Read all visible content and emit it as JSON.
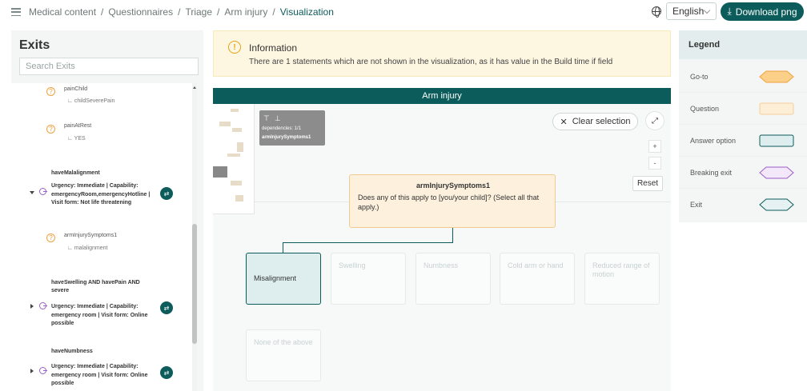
{
  "breadcrumb": {
    "items": [
      "Medical content",
      "Questionnaires",
      "Triage",
      "Arm injury"
    ],
    "active": "Visualization"
  },
  "language": {
    "selected": "English"
  },
  "download_button": {
    "label": "Download png"
  },
  "exits_panel": {
    "title": "Exits",
    "search_placeholder": "Search Exits",
    "questions": [
      {
        "name": "painChild",
        "value": "childSeverePain"
      },
      {
        "name": "painAtRest",
        "value": "YES"
      },
      {
        "name": "armInjurySymptoms1",
        "value": "malalignment"
      }
    ],
    "exits": [
      {
        "title": "haveMalalignment",
        "urgency_lines": [
          "Urgency: Immediate | Capability:",
          "emergencyRoom,emergencyHotline |",
          "Visit form: Not life threatening"
        ]
      },
      {
        "title_lines": [
          "haveSwelling AND havePain AND",
          "severe"
        ],
        "urgency_lines": [
          "Urgency: Immediate | Capability:",
          "emergency room | Visit form: Online",
          "possible"
        ]
      },
      {
        "title": "haveNumbness",
        "urgency_lines": [
          "Urgency: Immediate | Capability:",
          "emergency room | Visit form: Online",
          "possible"
        ]
      }
    ]
  },
  "info": {
    "title": "Information",
    "text": "There are 1 statements which are not shown in the visualization, as it has value in the Build time if field"
  },
  "visualization": {
    "header": "Arm injury",
    "tooltip": {
      "line1": "dependencies: 1/1",
      "line2": "armInjurySymptoms1"
    },
    "clear_selection": "Clear selection",
    "reset": "Reset",
    "question_node": {
      "title": "armInjurySymptoms1",
      "text": "Does any of this apply to [you/your child]? (Select all that apply.)"
    },
    "answers": [
      "Misalignment",
      "Swelling",
      "Numbness",
      "Cold arm or hand",
      "Reduced range of motion",
      "None of the above"
    ]
  },
  "legend": {
    "title": "Legend",
    "items": [
      {
        "label": "Go-to",
        "fill": "#fcd089",
        "stroke": "#f1a13a"
      },
      {
        "label": "Question",
        "fill": "#fdeed8",
        "stroke": "#f7cf9a"
      },
      {
        "label": "Answer option",
        "fill": "#deeeef",
        "stroke": "#0d5c5c"
      },
      {
        "label": "Breaking exit",
        "fill": "#f3e8fa",
        "stroke": "#9b5ec7"
      },
      {
        "label": "Exit",
        "fill": "#e6f2f2",
        "stroke": "#0d5c5c"
      }
    ]
  },
  "colors": {
    "primary": "#0d5c5c",
    "info_bg": "#fdf6e1",
    "question_bg": "#fdf1de"
  }
}
